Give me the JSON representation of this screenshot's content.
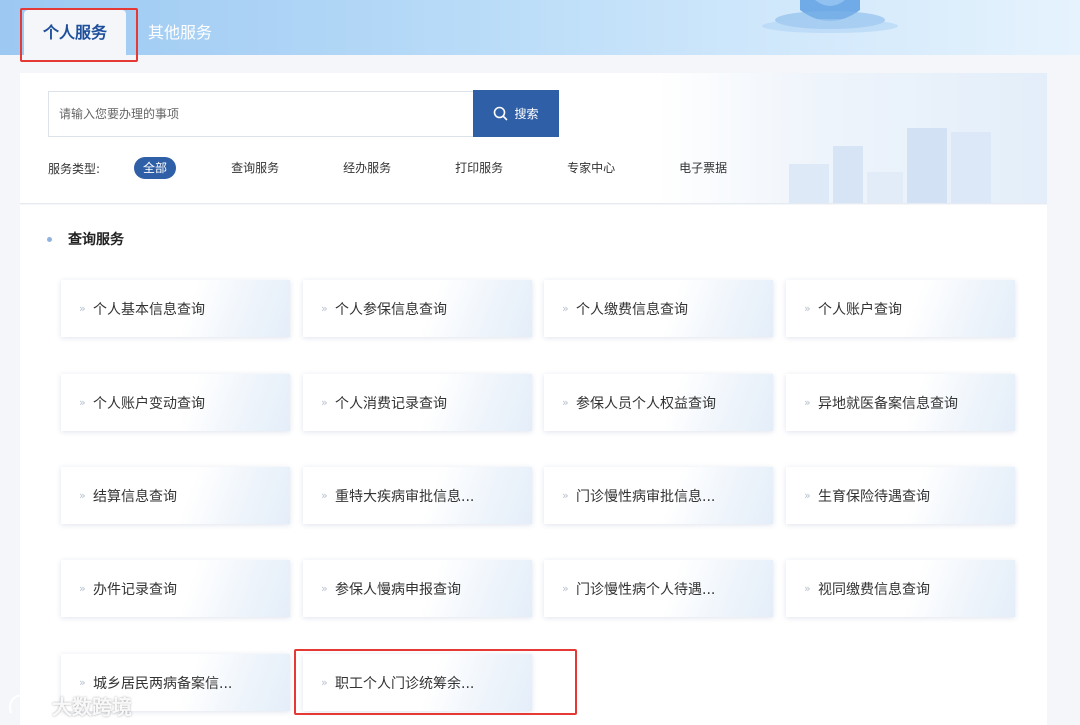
{
  "tabs": [
    {
      "label": "个人服务",
      "active": true
    },
    {
      "label": "其他服务",
      "active": false
    }
  ],
  "search": {
    "placeholder": "请输入您要办理的事项",
    "button_label": "搜索"
  },
  "filters": {
    "label": "服务类型:",
    "options": [
      "全部",
      "查询服务",
      "经办服务",
      "打印服务",
      "专家中心",
      "电子票据"
    ],
    "selected": "全部"
  },
  "section": {
    "title": "查询服务",
    "items": [
      "个人基本信息查询",
      "个人参保信息查询",
      "个人缴费信息查询",
      "个人账户查询",
      "个人账户变动查询",
      "个人消费记录查询",
      "参保人员个人权益查询",
      "异地就医备案信息查询",
      "结算信息查询",
      "重特大疾病审批信息...",
      "门诊慢性病审批信息...",
      "生育保险待遇查询",
      "办件记录查询",
      "参保人慢病申报查询",
      "门诊慢性病个人待遇...",
      "视同缴费信息查询",
      "城乡居民两病备案信...",
      "职工个人门诊统筹余..."
    ]
  },
  "watermark": "大数跨境",
  "colors": {
    "accent": "#2f5fa7",
    "highlight_box": "#e53935",
    "active_tab_text": "#1e4f9b"
  }
}
